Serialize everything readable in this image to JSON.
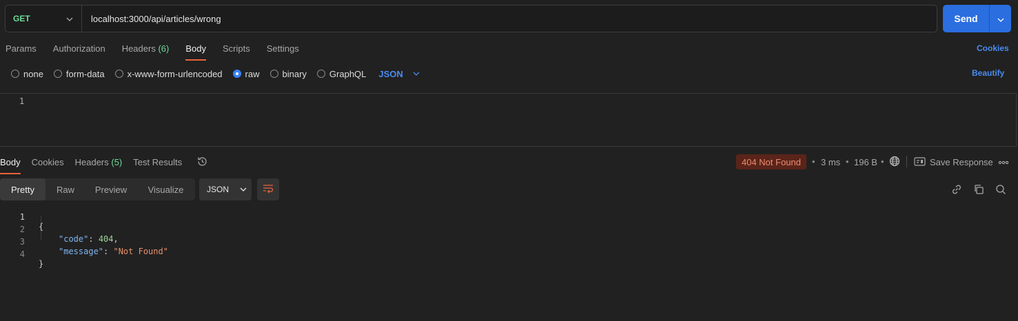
{
  "request": {
    "method": "GET",
    "url": "localhost:3000/api/articles/wrong",
    "send_label": "Send"
  },
  "request_tabs": [
    {
      "label": "Params"
    },
    {
      "label": "Authorization"
    },
    {
      "label": "Headers",
      "count": "(6)"
    },
    {
      "label": "Body",
      "active": true
    },
    {
      "label": "Scripts"
    },
    {
      "label": "Settings"
    }
  ],
  "cookies_link": "Cookies",
  "body_types": [
    {
      "label": "none",
      "selected": false
    },
    {
      "label": "form-data",
      "selected": false
    },
    {
      "label": "x-www-form-urlencoded",
      "selected": false
    },
    {
      "label": "raw",
      "selected": true
    },
    {
      "label": "binary",
      "selected": false
    },
    {
      "label": "GraphQL",
      "selected": false
    }
  ],
  "body_language": "JSON",
  "beautify_label": "Beautify",
  "editor": {
    "line_numbers": [
      "1"
    ]
  },
  "response_tabs": [
    {
      "label": "Body",
      "active": true
    },
    {
      "label": "Cookies"
    },
    {
      "label": "Headers",
      "count": "(5)"
    },
    {
      "label": "Test Results"
    }
  ],
  "response_meta": {
    "status": "404 Not Found",
    "time": "3 ms",
    "size": "196 B",
    "save_response": "Save Response"
  },
  "view_modes": [
    {
      "label": "Pretty",
      "active": true
    },
    {
      "label": "Raw"
    },
    {
      "label": "Preview"
    },
    {
      "label": "Visualize"
    }
  ],
  "response_format": "JSON",
  "response_body": {
    "line_numbers": [
      "1",
      "2",
      "3",
      "4"
    ],
    "open_brace": "{",
    "key_code": "\"code\"",
    "colon_1": ": ",
    "value_code": "404",
    "comma": ",",
    "key_message": "\"message\"",
    "colon_2": ": ",
    "value_message": "\"Not Found\"",
    "close_brace": "}"
  },
  "colors": {
    "accent": "#2a6ee0",
    "method_get": "#6bdd9a",
    "status_error_bg": "#5a241a",
    "status_error_text": "#f08b6e",
    "link": "#4a8bf0",
    "tab_underline": "#e8643b"
  },
  "icons": [
    "chevron-down-icon",
    "history-icon",
    "globe-icon",
    "save-response-icon",
    "more-icon",
    "wrap-lines-icon",
    "link-icon",
    "copy-icon",
    "search-icon"
  ]
}
